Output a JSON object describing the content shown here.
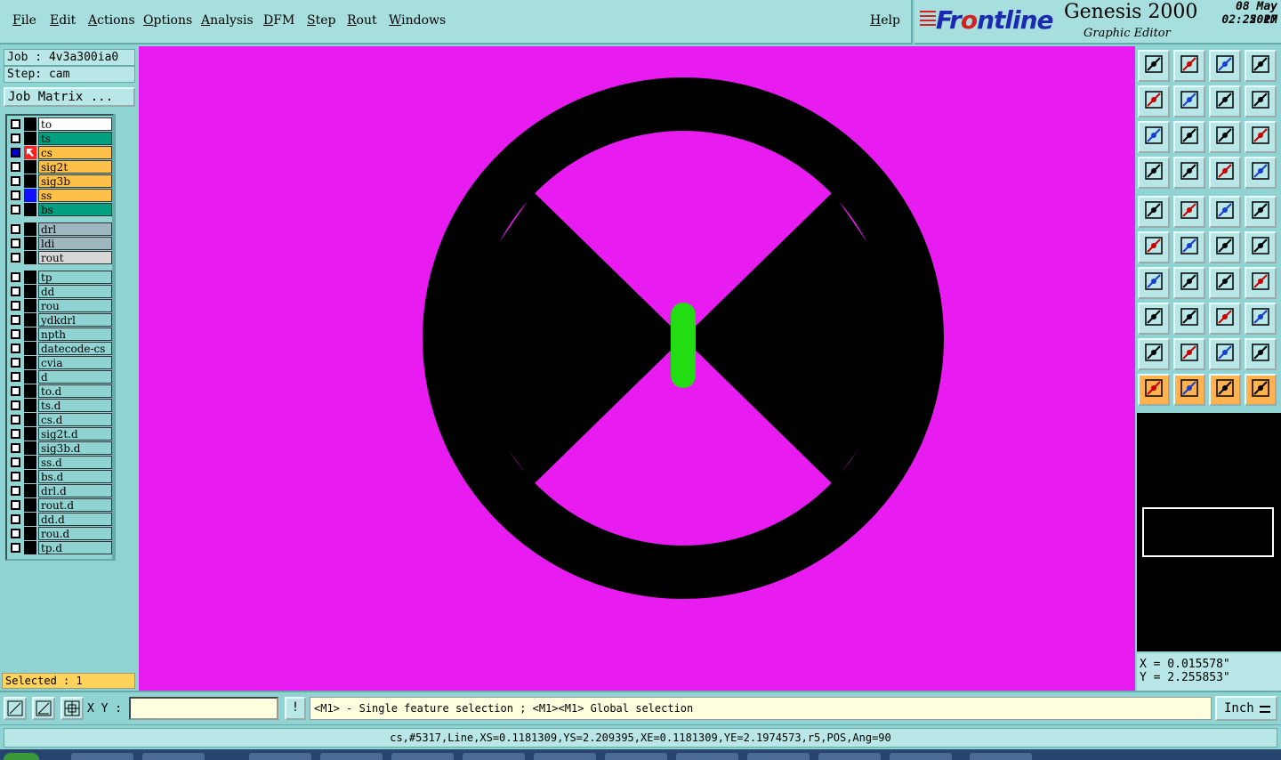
{
  "menubar": {
    "items": [
      "File",
      "Edit",
      "Actions",
      "Options",
      "Analysis",
      "DFM",
      "Step",
      "Rout",
      "Windows"
    ],
    "help": "Help"
  },
  "brand": {
    "logo_part1": "Fr",
    "logo_part2": "o",
    "logo_part3": "ntline",
    "product": "Genesis 2000",
    "subtitle": "Graphic Editor",
    "date": "08 May 2017",
    "time": "02:25 PM"
  },
  "left_panel": {
    "job": "Job : 4v3a300ia0",
    "step": "Step: cam",
    "job_matrix": "Job Matrix ...",
    "selected": "Selected : 1"
  },
  "layers": [
    {
      "name": "to",
      "color": "#ffffff",
      "mark": "#000000"
    },
    {
      "name": "ts",
      "color": "#00a080",
      "mark": "#000000"
    },
    {
      "name": "cs",
      "color": "#ffc04a",
      "mark": "#000000",
      "active": true
    },
    {
      "name": "sig2t",
      "color": "#ffc04a",
      "mark": "#000000"
    },
    {
      "name": "sig3b",
      "color": "#ffc04a",
      "mark": "#000000"
    },
    {
      "name": "ss",
      "color": "#ffc04a",
      "mark": "#1010ff"
    },
    {
      "name": "bs",
      "color": "#00a080",
      "mark": "#000000"
    },
    {
      "name": "drl",
      "color": "#9fb8c0",
      "mark": "#000000"
    },
    {
      "name": "ldi",
      "color": "#9fb8c0",
      "mark": "#000000"
    },
    {
      "name": "rout",
      "color": "#d8d8d8",
      "mark": "#000000"
    },
    {
      "name": "tp",
      "color": "#8fd3d3",
      "mark": "#000000"
    },
    {
      "name": "dd",
      "color": "#8fd3d3",
      "mark": "#000000"
    },
    {
      "name": "rou",
      "color": "#8fd3d3",
      "mark": "#000000"
    },
    {
      "name": "ydkdrl",
      "color": "#8fd3d3",
      "mark": "#000000"
    },
    {
      "name": "npth",
      "color": "#8fd3d3",
      "mark": "#000000"
    },
    {
      "name": "datecode-cs",
      "color": "#8fd3d3",
      "mark": "#000000"
    },
    {
      "name": "cvia",
      "color": "#8fd3d3",
      "mark": "#000000"
    },
    {
      "name": "d",
      "color": "#8fd3d3",
      "mark": "#000000"
    },
    {
      "name": "to.d",
      "color": "#8fd3d3",
      "mark": "#000000"
    },
    {
      "name": "ts.d",
      "color": "#8fd3d3",
      "mark": "#000000"
    },
    {
      "name": "cs.d",
      "color": "#8fd3d3",
      "mark": "#000000"
    },
    {
      "name": "sig2t.d",
      "color": "#8fd3d3",
      "mark": "#000000"
    },
    {
      "name": "sig3b.d",
      "color": "#8fd3d3",
      "mark": "#000000"
    },
    {
      "name": "ss.d",
      "color": "#8fd3d3",
      "mark": "#000000"
    },
    {
      "name": "bs.d",
      "color": "#8fd3d3",
      "mark": "#000000"
    },
    {
      "name": "drl.d",
      "color": "#8fd3d3",
      "mark": "#000000"
    },
    {
      "name": "rout.d",
      "color": "#8fd3d3",
      "mark": "#000000"
    },
    {
      "name": "dd.d",
      "color": "#8fd3d3",
      "mark": "#000000"
    },
    {
      "name": "rou.d",
      "color": "#8fd3d3",
      "mark": "#000000"
    },
    {
      "name": "tp.d",
      "color": "#8fd3d3",
      "mark": "#000000"
    }
  ],
  "canvas": {
    "background": "#e81cf0",
    "feature_color": "#000000",
    "selected_color": "#22dd11"
  },
  "tools": {
    "icons": [
      "layer-up-icon",
      "layer-down-icon",
      "home-icon",
      "window-icon",
      "snap-left-icon",
      "snap-right-icon",
      "undo-icon",
      "flip-icon",
      "fit-screen-icon",
      "zoom-fit-icon",
      "one-to-one-icon",
      "help-icon",
      "settings-icon",
      "measure-tool-icon",
      "net-highlight-icon",
      "net-select-icon",
      "pad-add-icon",
      "shape-edit-icon",
      "ruler-icon",
      "circle-pad-icon",
      "node-move-icon",
      "cross-delete-icon",
      "line-add-icon",
      "line-blue-icon",
      "angle-red-icon",
      "angle-blue-icon",
      "arc-icon",
      "font-text-icon",
      "copy-move-icon",
      "cut-line-icon",
      "resize-icon",
      "transform-icon",
      "slope-red-icon",
      "slope-peak-icon",
      "surface-red-icon",
      "surface-blue-icon",
      "select-arrow-icon",
      "select-box-icon",
      "select-circle-icon",
      "select-polyline-icon"
    ]
  },
  "coords": {
    "x": "X = 0.015578\"",
    "y": "Y = 2.255853\""
  },
  "bottom": {
    "xy_label": "X Y :",
    "xy_value": "",
    "prompt_btn": "!",
    "prompt": "<M1> - Single feature selection ; <M1><M1> Global selection",
    "units": "Inch"
  },
  "feature_info": "cs,#5317,Line,XS=0.1181309,YS=2.209395,XE=0.1181309,YE=2.1974573,r5,POS,Ang=90"
}
